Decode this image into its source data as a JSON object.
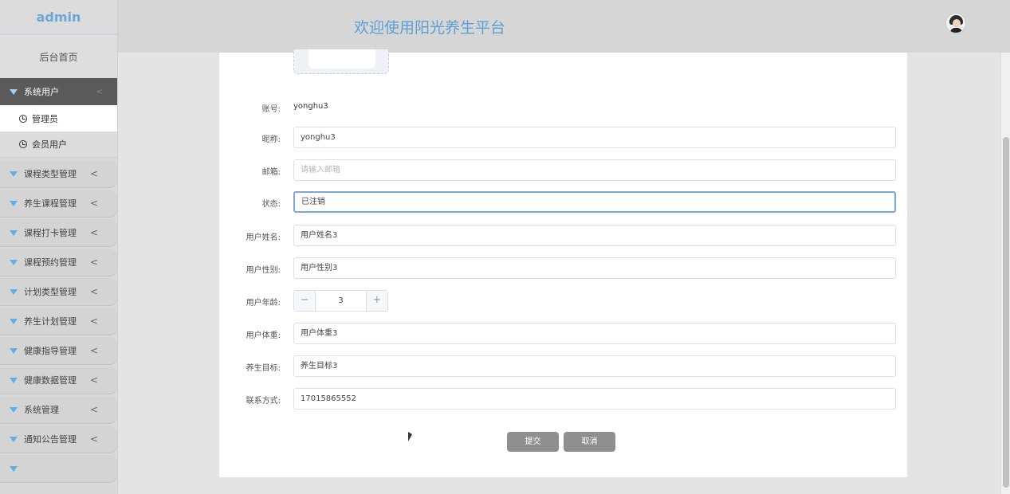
{
  "sidebar": {
    "brand": "admin",
    "home": "后台首页",
    "active_group": "系统用户",
    "sub_items": [
      "管理员",
      "会员用户"
    ],
    "menu_items": [
      "课程类型管理",
      "养生课程管理",
      "课程打卡管理",
      "课程预约管理",
      "计划类型管理",
      "养生计划管理",
      "健康指导管理",
      "健康数据管理",
      "系统管理",
      "通知公告管理"
    ],
    "chevron": "<"
  },
  "header": {
    "title": "欢迎使用阳光养生平台"
  },
  "form": {
    "account_label": "账号:",
    "account_value": "yonghu3",
    "nickname_label": "昵称:",
    "nickname_value": "yonghu3",
    "email_label": "邮箱:",
    "email_placeholder": "请输入邮箱",
    "status_label": "状态:",
    "status_value": "已注销",
    "name_label": "用户姓名:",
    "name_value": "用户姓名3",
    "gender_label": "用户性别:",
    "gender_value": "用户性别3",
    "age_label": "用户年龄:",
    "age_value": "3",
    "minus": "−",
    "plus": "+",
    "weight_label": "用户体重:",
    "weight_value": "用户体重3",
    "goal_label": "养生目标:",
    "goal_value": "养生目标3",
    "contact_label": "联系方式:",
    "contact_value": "17015865552",
    "submit": "提交",
    "cancel": "取消"
  }
}
